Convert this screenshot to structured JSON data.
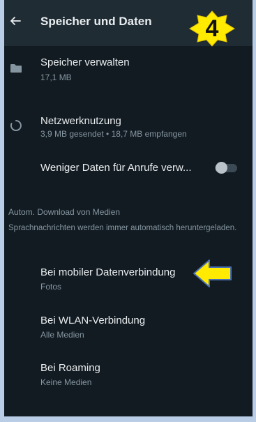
{
  "header": {
    "title": "Speicher und Daten",
    "step_number": "4"
  },
  "storage": {
    "title": "Speicher verwalten",
    "subtitle": "17,1 MB"
  },
  "network": {
    "title": "Netzwerknutzung",
    "subtitle": "3,9 MB gesendet • 18,7 MB empfangen"
  },
  "less_data": {
    "label": "Weniger Daten für Anrufe verw...",
    "enabled": false
  },
  "media_download": {
    "section_title": "Autom. Download von Medien",
    "note": "Sprachnachrichten werden immer automatisch heruntergeladen.",
    "items": [
      {
        "title": "Bei mobiler Datenverbindung",
        "subtitle": "Fotos"
      },
      {
        "title": "Bei WLAN-Verbindung",
        "subtitle": "Alle Medien"
      },
      {
        "title": "Bei Roaming",
        "subtitle": "Keine Medien"
      }
    ]
  },
  "colors": {
    "background": "#121b22",
    "appbar": "#1f2c34",
    "text_primary": "#e9edef",
    "text_secondary": "#8696a0",
    "annotation_yellow": "#ffea00",
    "page_border": "#b9cde6"
  },
  "icons": {
    "back": "arrow-left-icon",
    "storage": "folder-icon",
    "network": "data-usage-circle-icon"
  }
}
